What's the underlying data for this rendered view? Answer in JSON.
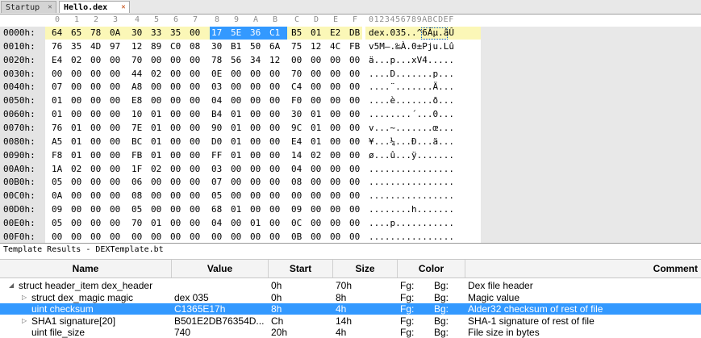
{
  "tabs": [
    {
      "label": "Startup",
      "active": false
    },
    {
      "label": "Hello.dex",
      "active": true
    }
  ],
  "hex_editor": {
    "column_headers": [
      "0",
      "1",
      "2",
      "3",
      "4",
      "5",
      "6",
      "7",
      "8",
      "9",
      "A",
      "B",
      "C",
      "D",
      "E",
      "F"
    ],
    "ascii_header": "0123456789ABCDEF",
    "rows": [
      {
        "addr": "0000h:",
        "bytes": [
          "64",
          "65",
          "78",
          "0A",
          "30",
          "33",
          "35",
          "00",
          "17",
          "5E",
          "36",
          "C1",
          "B5",
          "01",
          "E2",
          "DB"
        ],
        "ascii": "dex.035..^6Áµ.âÛ"
      },
      {
        "addr": "0010h:",
        "bytes": [
          "76",
          "35",
          "4D",
          "97",
          "12",
          "89",
          "C0",
          "08",
          "30",
          "B1",
          "50",
          "6A",
          "75",
          "12",
          "4C",
          "FB"
        ],
        "ascii": "v5M—.‰À.0±Pju.Lû"
      },
      {
        "addr": "0020h:",
        "bytes": [
          "E4",
          "02",
          "00",
          "00",
          "70",
          "00",
          "00",
          "00",
          "78",
          "56",
          "34",
          "12",
          "00",
          "00",
          "00",
          "00"
        ],
        "ascii": "ä...p...xV4....."
      },
      {
        "addr": "0030h:",
        "bytes": [
          "00",
          "00",
          "00",
          "00",
          "44",
          "02",
          "00",
          "00",
          "0E",
          "00",
          "00",
          "00",
          "70",
          "00",
          "00",
          "00"
        ],
        "ascii": "....D.......p..."
      },
      {
        "addr": "0040h:",
        "bytes": [
          "07",
          "00",
          "00",
          "00",
          "A8",
          "00",
          "00",
          "00",
          "03",
          "00",
          "00",
          "00",
          "C4",
          "00",
          "00",
          "00"
        ],
        "ascii": "....¨.......Ä..."
      },
      {
        "addr": "0050h:",
        "bytes": [
          "01",
          "00",
          "00",
          "00",
          "E8",
          "00",
          "00",
          "00",
          "04",
          "00",
          "00",
          "00",
          "F0",
          "00",
          "00",
          "00"
        ],
        "ascii": "....è.......ð..."
      },
      {
        "addr": "0060h:",
        "bytes": [
          "01",
          "00",
          "00",
          "00",
          "10",
          "01",
          "00",
          "00",
          "B4",
          "01",
          "00",
          "00",
          "30",
          "01",
          "00",
          "00"
        ],
        "ascii": "........´...0..."
      },
      {
        "addr": "0070h:",
        "bytes": [
          "76",
          "01",
          "00",
          "00",
          "7E",
          "01",
          "00",
          "00",
          "90",
          "01",
          "00",
          "00",
          "9C",
          "01",
          "00",
          "00"
        ],
        "ascii": "v...~.......œ..."
      },
      {
        "addr": "0080h:",
        "bytes": [
          "A5",
          "01",
          "00",
          "00",
          "BC",
          "01",
          "00",
          "00",
          "D0",
          "01",
          "00",
          "00",
          "E4",
          "01",
          "00",
          "00"
        ],
        "ascii": "¥...¼...Ð...ä..."
      },
      {
        "addr": "0090h:",
        "bytes": [
          "F8",
          "01",
          "00",
          "00",
          "FB",
          "01",
          "00",
          "00",
          "FF",
          "01",
          "00",
          "00",
          "14",
          "02",
          "00",
          "00"
        ],
        "ascii": "ø...û...ÿ......."
      },
      {
        "addr": "00A0h:",
        "bytes": [
          "1A",
          "02",
          "00",
          "00",
          "1F",
          "02",
          "00",
          "00",
          "03",
          "00",
          "00",
          "00",
          "04",
          "00",
          "00",
          "00"
        ],
        "ascii": "................"
      },
      {
        "addr": "00B0h:",
        "bytes": [
          "05",
          "00",
          "00",
          "00",
          "06",
          "00",
          "00",
          "00",
          "07",
          "00",
          "00",
          "00",
          "08",
          "00",
          "00",
          "00"
        ],
        "ascii": "................"
      },
      {
        "addr": "00C0h:",
        "bytes": [
          "0A",
          "00",
          "00",
          "00",
          "08",
          "00",
          "00",
          "00",
          "05",
          "00",
          "00",
          "00",
          "00",
          "00",
          "00",
          "00"
        ],
        "ascii": "................"
      },
      {
        "addr": "00D0h:",
        "bytes": [
          "09",
          "00",
          "00",
          "00",
          "05",
          "00",
          "00",
          "00",
          "68",
          "01",
          "00",
          "00",
          "09",
          "00",
          "00",
          "00"
        ],
        "ascii": "........h......."
      },
      {
        "addr": "00E0h:",
        "bytes": [
          "05",
          "00",
          "00",
          "00",
          "70",
          "01",
          "00",
          "00",
          "04",
          "00",
          "01",
          "00",
          "0C",
          "00",
          "00",
          "00"
        ],
        "ascii": "....p..........."
      },
      {
        "addr": "00F0h:",
        "bytes": [
          "00",
          "00",
          "00",
          "00",
          "00",
          "00",
          "00",
          "00",
          "00",
          "00",
          "00",
          "00",
          "0B",
          "00",
          "00",
          "00"
        ],
        "ascii": "................"
      }
    ]
  },
  "template_results": {
    "title": "Template Results - DEXTemplate.bt",
    "columns": [
      "Name",
      "Value",
      "Start",
      "Size",
      "Color",
      "Comment"
    ],
    "rows": [
      {
        "name": "struct header_item dex_header",
        "value": "",
        "start": "0h",
        "size": "70h",
        "fg": "Fg:",
        "bg": "Bg:",
        "comment": "Dex file header",
        "expander": "expanded",
        "selected": false
      },
      {
        "name": "struct dex_magic magic",
        "value": "dex 035",
        "start": "0h",
        "size": "8h",
        "fg": "Fg:",
        "bg": "Bg:",
        "comment": "Magic value",
        "expander": "collapsed",
        "selected": false
      },
      {
        "name": "uint checksum",
        "value": "C1365E17h",
        "start": "8h",
        "size": "4h",
        "fg": "Fg:",
        "bg": "Bg:",
        "comment": "Alder32 checksum of rest of file",
        "expander": "none",
        "selected": true
      },
      {
        "name": "SHA1 signature[20]",
        "value": "B501E2DB76354D...",
        "start": "Ch",
        "size": "14h",
        "fg": "Fg:",
        "bg": "Bg:",
        "comment": "SHA-1 signature of rest of file",
        "expander": "collapsed",
        "selected": false
      },
      {
        "name": "uint file_size",
        "value": "740",
        "start": "20h",
        "size": "4h",
        "fg": "Fg:",
        "bg": "Bg:",
        "comment": "File size in bytes",
        "expander": "none",
        "selected": false
      }
    ]
  },
  "colors": {
    "selection": "#3399ff",
    "first_row_highlight": "#fbf7b7",
    "address_column_bg": "#e4e4e4"
  }
}
